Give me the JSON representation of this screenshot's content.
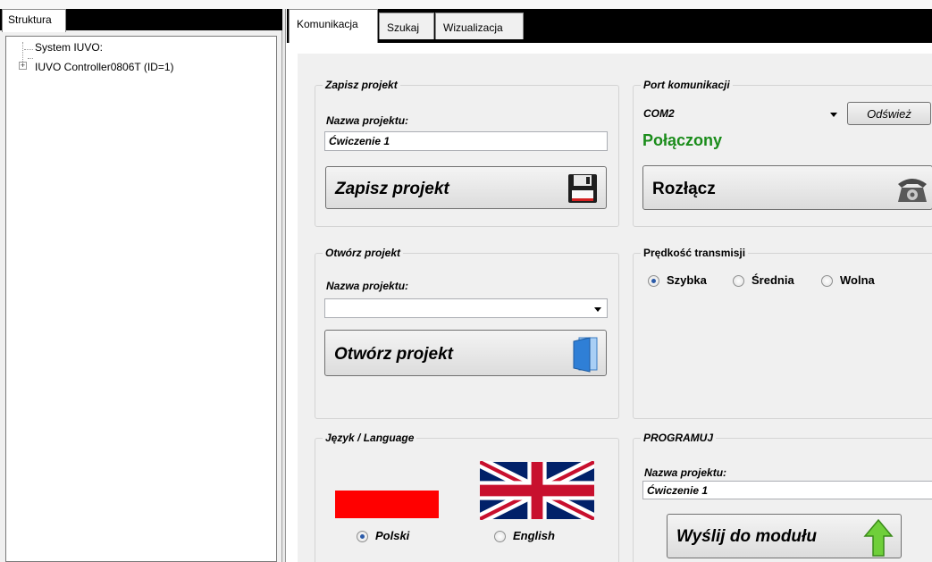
{
  "left": {
    "tab": "Struktura",
    "tree": [
      {
        "label": "System IUVO:"
      },
      {
        "label": "IUVO Controller0806T (ID=1)",
        "expander": "+"
      }
    ]
  },
  "tabs": [
    "Komunikacja",
    "Szukaj",
    "Wizualizacja"
  ],
  "save": {
    "title": "Zapisz projekt",
    "name_label": "Nazwa projektu:",
    "name_value": "Ćwiczenie 1",
    "button": "Zapisz projekt",
    "icon": "floppy-disk-icon"
  },
  "port": {
    "title": "Port komunikacji",
    "port_value": "COM2",
    "refresh": "Odśwież",
    "status": "Połączony",
    "status_color": "#1a8c1a",
    "button": "Rozłącz",
    "icon": "telephone-icon"
  },
  "open": {
    "title": "Otwórz projekt",
    "name_label": "Nazwa projektu:",
    "name_value": "",
    "button": "Otwórz projekt",
    "icon": "folder-icon"
  },
  "speed": {
    "title": "Prędkość transmisji",
    "options": [
      "Szybka",
      "Średnia",
      "Wolna"
    ],
    "selected": "Szybka"
  },
  "language": {
    "title": "Język / Language",
    "options": [
      "Polski",
      "English"
    ],
    "selected": "Polski",
    "icons": [
      "poland-flag-icon",
      "uk-flag-icon"
    ]
  },
  "program": {
    "title": "PROGRAMUJ",
    "name_label": "Nazwa projektu:",
    "name_value": "Ćwiczenie 1",
    "button": "Wyślij do modułu",
    "icon": "up-arrow-icon"
  }
}
